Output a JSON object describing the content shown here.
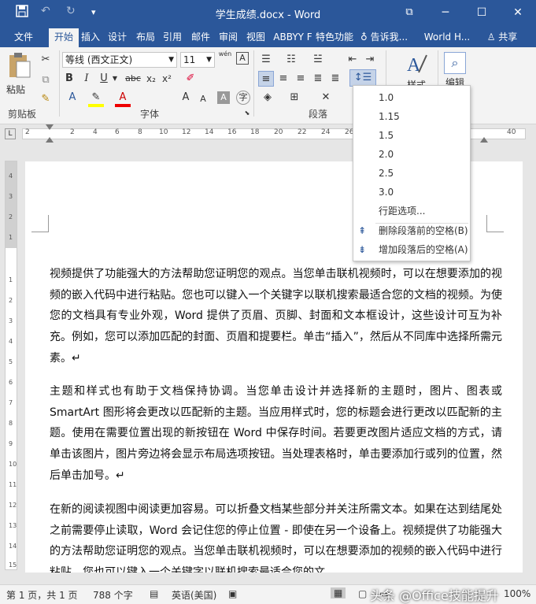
{
  "window": {
    "title": "学生成绩.docx - Word",
    "minimize": "─",
    "restore": "☐",
    "close": "✕",
    "ribbon_display": "⧉"
  },
  "qat": {
    "undo": "↶",
    "redo": "↻",
    "more": "▾"
  },
  "tabs": [
    "文件",
    "开始",
    "插入",
    "设计",
    "布局",
    "引用",
    "邮件",
    "审阅",
    "视图",
    "ABBYY F",
    "特色功能"
  ],
  "tellme": "告诉我...",
  "account": "World H...",
  "share": "共享",
  "clipboard": {
    "paste": "粘贴",
    "group": "剪贴板"
  },
  "font": {
    "name": "等线 (西文正文)",
    "size": "11",
    "wen": "wén",
    "group": "字体"
  },
  "paragraph": {
    "group": "段落"
  },
  "styles": {
    "label": "样式"
  },
  "editing": {
    "label": "编辑"
  },
  "ruler": [
    "2",
    "2",
    "4",
    "6",
    "8",
    "10",
    "12",
    "14",
    "16",
    "18",
    "20",
    "22",
    "24",
    "26",
    "40"
  ],
  "vruler": [
    "4",
    "3",
    "2",
    "1",
    "1",
    "2",
    "3",
    "4",
    "5",
    "6",
    "7",
    "8",
    "9",
    "10",
    "11",
    "12",
    "13",
    "14",
    "15"
  ],
  "line_spacing_menu": {
    "options": [
      "1.0",
      "1.15",
      "1.5",
      "2.0",
      "2.5",
      "3.0"
    ],
    "more": "行距选项...",
    "remove_before": "删除段落前的空格(B)",
    "add_after": "增加段落后的空格(A)"
  },
  "document": {
    "paragraphs": [
      "视频提供了功能强大的方法帮助您证明您的观点。当您单击联机视频时，可以在想要添加的视频的嵌入代码中进行粘贴。您也可以键入一个关键字以联机搜索最适合您的文档的视频。为使您的文档具有专业外观，Word 提供了页眉、页脚、封面和文本框设计，这些设计可互为补充。例如，您可以添加匹配的封面、页眉和提要栏。单击“插入”，然后从不同库中选择所需元素。↵",
      "主题和样式也有助于文档保持协调。当您单击设计并选择新的主题时，图片、图表或 SmartArt 图形将会更改以匹配新的主题。当应用样式时，您的标题会进行更改以匹配新的主题。使用在需要位置出现的新按钮在 Word 中保存时间。若要更改图片适应文档的方式，请单击该图片，图片旁边将会显示布局选项按钮。当处理表格时，单击要添加行或列的位置，然后单击加号。↵",
      "在新的阅读视图中阅读更加容易。可以折叠文档某些部分并关注所需文本。如果在达到结尾处之前需要停止读取，Word 会记住您的停止位置 - 即使在另一个设备上。视频提供了功能强大的方法帮助您证明您的观点。当您单击联机视频时，可以在想要添加的视频的嵌入代码中进行粘贴。您也可以键入一个关键字以联机搜索最适合您的文"
    ]
  },
  "status": {
    "page": "第 1 页，共 1 页",
    "words": "788 个字",
    "lang": "英语(美国)",
    "zoom": "100%"
  },
  "watermark": "头条 @Office技能提升"
}
